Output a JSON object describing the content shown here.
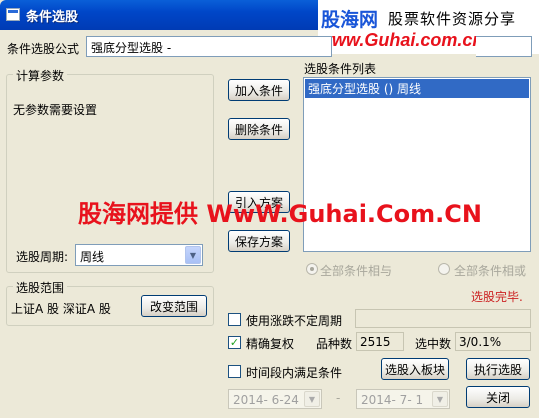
{
  "window": {
    "title": "条件选股"
  },
  "watermark": {
    "brand": "股海网",
    "slogan": "股票软件资源分享",
    "url": "www.Guhai.com.cn",
    "overlay": "股海网提供 WwW.Guhai.Com.CN"
  },
  "formula": {
    "label": "条件选股公式",
    "value": "强底分型选股 -"
  },
  "params": {
    "legend": "计算参数",
    "message": "无参数需要设置",
    "period_label": "选股周期:",
    "period_value": "周线"
  },
  "actions": {
    "add": "加入条件",
    "delete": "删除条件",
    "import": "引入方案",
    "save": "保存方案"
  },
  "condition_list": {
    "label": "选股条件列表",
    "items": [
      "强底分型选股 () 周线"
    ]
  },
  "logic": {
    "all_and": "全部条件相与",
    "all_or": "全部条件相或"
  },
  "status": {
    "text": "选股完毕.",
    "color": "#cc2222"
  },
  "range": {
    "legend": "选股范围",
    "value": "上证A 股 深证A 股",
    "change_button": "改变范围"
  },
  "options": {
    "uneven_period": {
      "label": "使用涨跌不定周期",
      "checked": false
    },
    "precise_restore": {
      "label": "精确复权",
      "checked": true
    },
    "time_period": {
      "label": "时间段内满足条件",
      "checked": false
    }
  },
  "stats": {
    "count_label": "品种数",
    "count_value": "2515",
    "selected_label": "选中数",
    "selected_value": "3/0.1%"
  },
  "dates": {
    "start": "2014- 6-24",
    "separator": "-",
    "end": "2014- 7- 1"
  },
  "buttons": {
    "to_block": "选股入板块",
    "execute": "执行选股",
    "close": "关闭"
  }
}
